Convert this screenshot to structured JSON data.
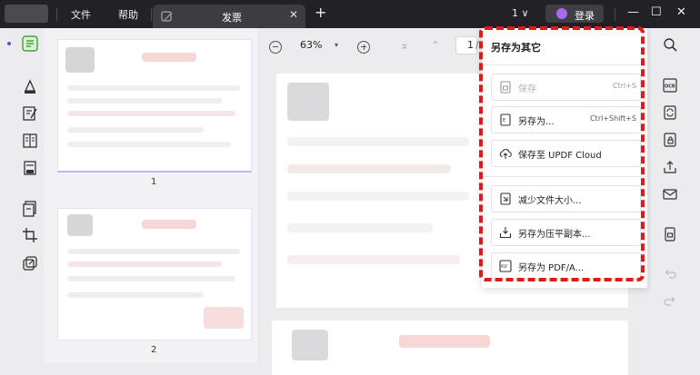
{
  "titlebar": {
    "menu": [
      "文件",
      "帮助"
    ],
    "tab_title": "发票",
    "tab_close": "✕",
    "tab_add": "+",
    "window_count": "1 ∨",
    "login_label": "登录",
    "window_controls": [
      "—",
      "☐",
      "✕"
    ]
  },
  "thumbnails": [
    {
      "page": "1"
    },
    {
      "page": "2"
    }
  ],
  "toolbar": {
    "zoom": "63%",
    "zoom_caret": "▾",
    "first_page_icon": "⌅",
    "prev_page_icon": "⌃",
    "current_page": "1",
    "page_slash": "/"
  },
  "save_panel": {
    "title": "另存为其它",
    "options": [
      {
        "label": "保存",
        "shortcut": "Ctrl+S",
        "icon": "save-icon",
        "enabled": false
      },
      {
        "label": "另存为...",
        "shortcut": "Ctrl+Shift+S",
        "icon": "save-as-icon",
        "enabled": true
      },
      {
        "label": "保存至 UPDF Cloud",
        "icon": "cloud-upload-icon",
        "enabled": true
      },
      {
        "label": "减少文件大小...",
        "icon": "compress-icon",
        "enabled": true
      },
      {
        "label": "另存为压平副本...",
        "icon": "flatten-icon",
        "enabled": true
      },
      {
        "label": "另存为 PDF/A...",
        "icon": "pdfa-icon",
        "enabled": true
      }
    ]
  },
  "colors": {
    "titlebar": "#222226",
    "accent": "#7b3fe4",
    "highlight": "#e0191b"
  }
}
